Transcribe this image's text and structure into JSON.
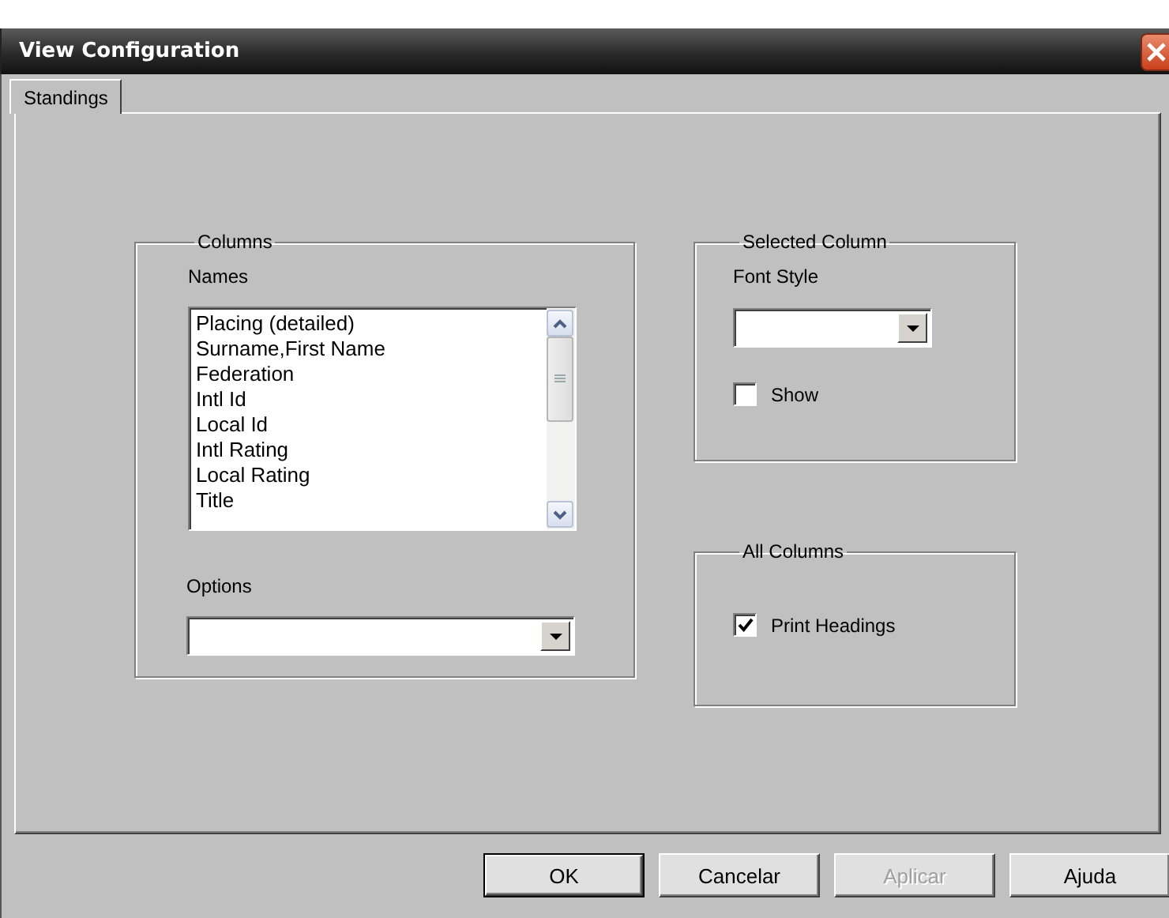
{
  "window": {
    "title": "View Configuration"
  },
  "tabs": [
    {
      "label": "Standings",
      "selected": true
    }
  ],
  "columns_group": {
    "title": "Columns",
    "names_label": "Names",
    "names": [
      "Placing (detailed)",
      "Surname,First Name",
      "Federation",
      "Intl Id",
      "Local Id",
      "Intl Rating",
      "Local Rating",
      "Title"
    ],
    "options_label": "Options"
  },
  "selected_column_group": {
    "title": "Selected Column",
    "font_style_label": "Font Style",
    "show": {
      "label": "Show",
      "checked": false
    }
  },
  "all_columns_group": {
    "title": "All Columns",
    "print_headings": {
      "label": "Print Headings",
      "checked": true
    }
  },
  "buttons": [
    {
      "label": "OK",
      "default": true,
      "disabled": false
    },
    {
      "label": "Cancelar",
      "default": false,
      "disabled": false
    },
    {
      "label": "Aplicar",
      "default": false,
      "disabled": true
    },
    {
      "label": "Ajuda",
      "default": false,
      "disabled": false
    }
  ]
}
